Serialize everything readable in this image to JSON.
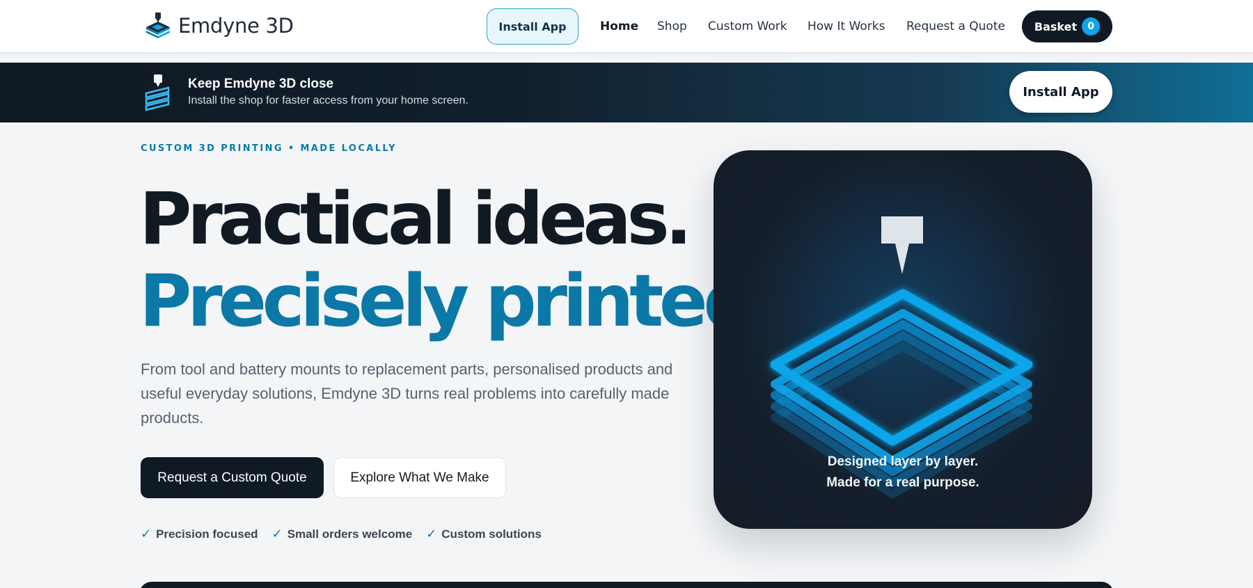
{
  "header": {
    "brand_name": "Emdyne 3D",
    "install_label": "Install App",
    "nav": [
      "Home",
      "Shop",
      "Custom Work",
      "How It Works",
      "Request a Quote"
    ],
    "basket_label": "Basket",
    "basket_count": "0"
  },
  "banner": {
    "title": "Keep Emdyne 3D close",
    "subtitle": "Install the shop for faster access from your home screen.",
    "install_label": "Install App"
  },
  "hero": {
    "eyebrow": "CUSTOM 3D PRINTING • MADE LOCALLY",
    "headline_1": "Practical ideas.",
    "headline_2": "Precisely printed.",
    "lead": "From tool and battery mounts to replacement parts, personalised products and useful everyday solutions, Emdyne 3D turns real problems into carefully made products.",
    "primary_cta": "Request a Custom Quote",
    "secondary_cta": "Explore What We Make",
    "features": [
      "Precision focused",
      "Small orders welcome",
      "Custom solutions"
    ]
  },
  "visual": {
    "caption_1": "Designed layer by layer.",
    "caption_2": "Made for a real purpose."
  },
  "colors": {
    "accent": "#0b78a7",
    "dark": "#0f1a25",
    "glow": "#0ea5e9"
  },
  "icons": [
    "printer-logo-icon",
    "printer-layers-icon",
    "check-icon"
  ]
}
